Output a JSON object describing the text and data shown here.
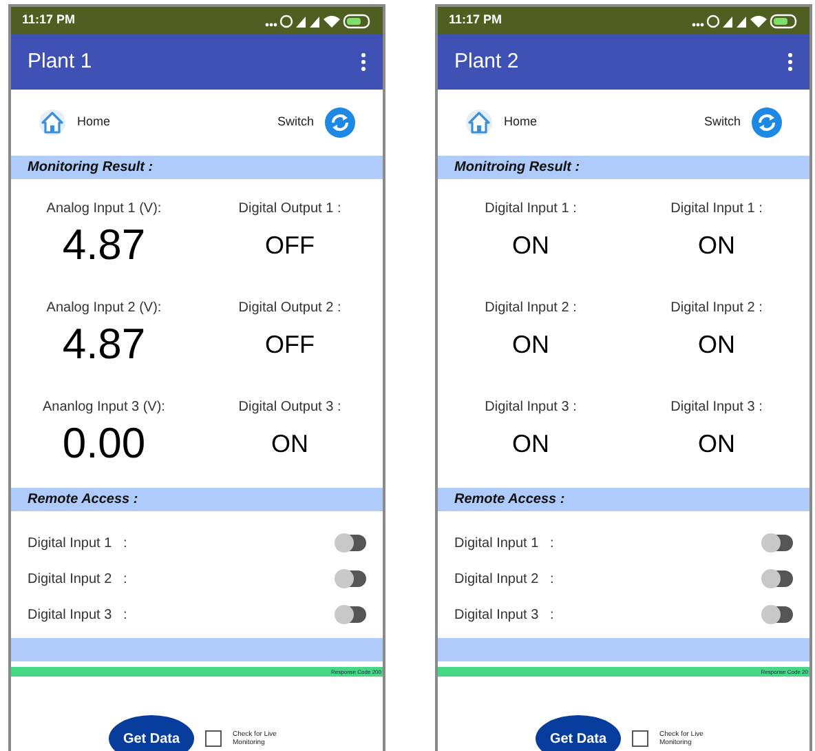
{
  "phones": [
    {
      "status_time": "11:17 PM",
      "title": "Plant 1",
      "home": "Home",
      "switch": "Switch",
      "monitoring": {
        "heading": "Monitoring Result :",
        "cells": [
          {
            "label": "Analog Input 1 (V):",
            "value": "4.87",
            "kind": "analog"
          },
          {
            "label": "Digital Output 1 :",
            "value": "OFF",
            "kind": "digital"
          },
          {
            "label": "Analog Input 2 (V):",
            "value": "4.87",
            "kind": "analog"
          },
          {
            "label": "Digital Output 2 :",
            "value": "OFF",
            "kind": "digital"
          },
          {
            "label": "Ananlog Input 3 (V):",
            "value": "0.00",
            "kind": "analog"
          },
          {
            "label": "Digital Output 3 :",
            "value": "ON",
            "kind": "digital"
          }
        ]
      },
      "remote": {
        "heading": "Remote Access :",
        "inputs": [
          {
            "label": "Digital Input 1   :",
            "on": false
          },
          {
            "label": "Digital Input 2   :",
            "on": false
          },
          {
            "label": "Digital Input 3   :",
            "on": false
          }
        ]
      },
      "response_code": "Response Code 200",
      "button": "Get Data",
      "checkbox": {
        "label": "Check for Live Monitoring",
        "checked": false
      }
    },
    {
      "status_time": "11:17 PM",
      "title": "Plant 2",
      "home": "Home",
      "switch": "Switch",
      "monitoring": {
        "heading": "Monitroing Result  :",
        "cells": [
          {
            "label": "Digital Input 1 :",
            "value": "ON",
            "kind": "digital"
          },
          {
            "label": "Digital Input 1  :",
            "value": "ON",
            "kind": "digital"
          },
          {
            "label": "Digital Input 2 :",
            "value": "ON",
            "kind": "digital"
          },
          {
            "label": "Digital Input 2  :",
            "value": "ON",
            "kind": "digital"
          },
          {
            "label": "Digital Input 3 :",
            "value": "ON",
            "kind": "digital"
          },
          {
            "label": "Digital Input 3  :",
            "value": "ON",
            "kind": "digital"
          }
        ]
      },
      "remote": {
        "heading": "Remote Access  :",
        "inputs": [
          {
            "label": "Digital Input 1   :",
            "on": false
          },
          {
            "label": "Digital Input 2   :",
            "on": false
          },
          {
            "label": "Digital Input 3   :",
            "on": false
          }
        ]
      },
      "response_code": "Response Code 20",
      "button": "Get Data",
      "checkbox": {
        "label": "Check for Live Monitoring",
        "checked": false
      }
    }
  ]
}
